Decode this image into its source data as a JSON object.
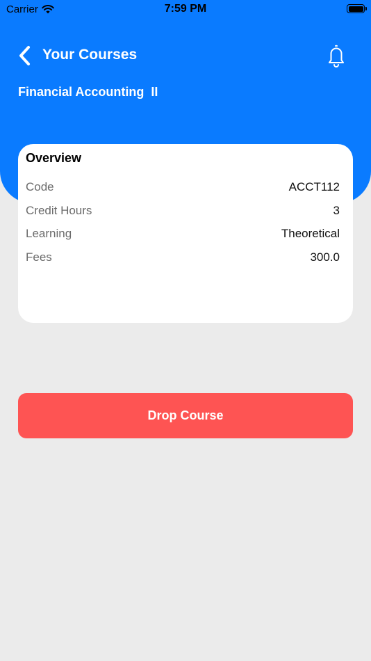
{
  "status_bar": {
    "carrier": "Carrier",
    "time": "7:59 PM",
    "wifi_icon": "wifi-icon",
    "battery_icon": "battery-icon"
  },
  "header": {
    "title": "Your Courses",
    "back_icon": "chevron-left-icon",
    "notification_icon": "bell-icon",
    "course_name": "Financial Accounting  II",
    "background_color": "#0a7bff"
  },
  "overview": {
    "title": "Overview",
    "rows": [
      {
        "label": "Code",
        "value": "ACCT112"
      },
      {
        "label": "Credit Hours",
        "value": "3"
      },
      {
        "label": "Learning",
        "value": "Theoretical"
      },
      {
        "label": "Fees",
        "value": "300.0"
      }
    ]
  },
  "actions": {
    "drop_label": "Drop Course",
    "drop_color": "#fe5453"
  }
}
